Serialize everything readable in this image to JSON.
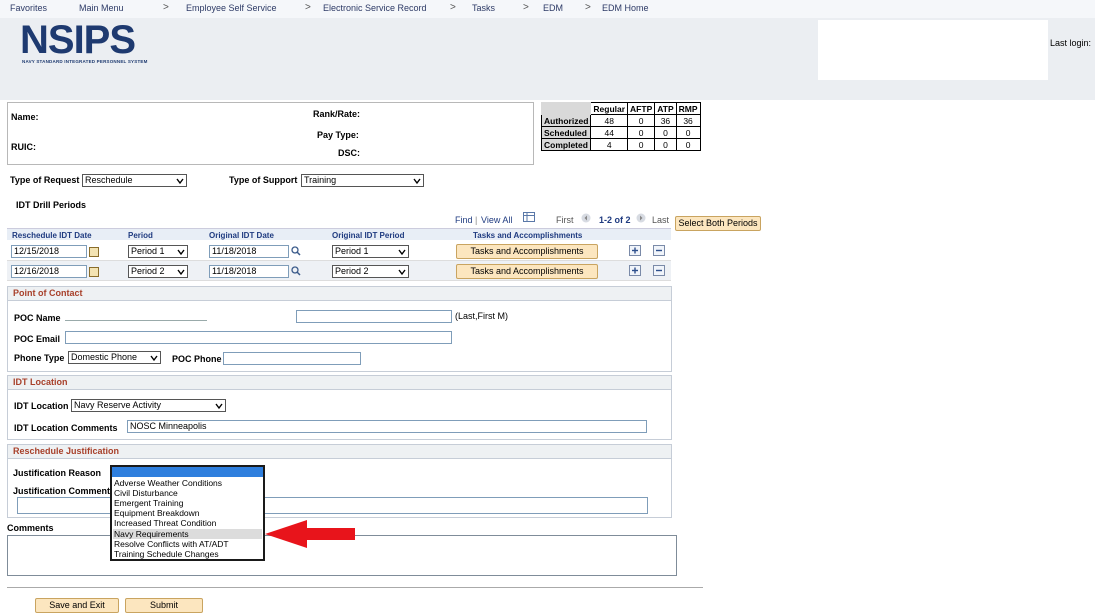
{
  "nav": {
    "favorites": "Favorites",
    "main_menu": "Main Menu",
    "crumbs": [
      "Employee Self Service",
      "Electronic Service Record",
      "Tasks",
      "EDM",
      "EDM Home"
    ],
    "sep": ">"
  },
  "header": {
    "logo_text": "NSIPS",
    "logo_subtitle": "NAVY STANDARD INTEGRATED PERSONNEL SYSTEM",
    "last_login_label": "Last login: "
  },
  "member": {
    "name_label": "Name:",
    "ruic_label": "RUIC:",
    "rank_label": "Rank/Rate:",
    "paytype_label": "Pay Type:",
    "dsc_label": "DSC:"
  },
  "stats": {
    "columns": [
      "Regular",
      "AFTP",
      "ATP",
      "RMP"
    ],
    "rows": [
      {
        "label": "Authorized",
        "values": [
          "48",
          "0",
          "36",
          "36"
        ]
      },
      {
        "label": "Scheduled",
        "values": [
          "44",
          "0",
          "0",
          "0"
        ]
      },
      {
        "label": "Completed",
        "values": [
          "4",
          "0",
          "0",
          "0"
        ]
      }
    ]
  },
  "request": {
    "type_label": "Type of Request",
    "type_value": "Reschedule",
    "support_label": "Type of Support",
    "support_value": "Training"
  },
  "drill": {
    "title": "IDT Drill Periods",
    "find": "Find",
    "view_all": "View All",
    "first": "First",
    "range": "1-2 of 2",
    "last": "Last",
    "select_both": "Select Both Periods",
    "col_reschedule": "Reschedule IDT Date",
    "col_period": "Period",
    "col_original_date": "Original IDT Date",
    "col_original_period": "Original IDT Period",
    "col_tasks": "Tasks and Accomplishments",
    "rows": [
      {
        "date": "12/15/2018",
        "period": "Period 1",
        "orig_date": "11/18/2018",
        "orig_period": "Period 1",
        "tasks_btn": "Tasks and Accomplishments"
      },
      {
        "date": "12/16/2018",
        "period": "Period 2",
        "orig_date": "11/18/2018",
        "orig_period": "Period 2",
        "tasks_btn": "Tasks and Accomplishments"
      }
    ]
  },
  "poc": {
    "title": "Point of Contact",
    "name_label": "POC Name",
    "name_hint": "(Last,First M)",
    "email_label": "POC Email",
    "phone_type_label": "Phone Type",
    "phone_type_value": "Domestic Phone",
    "phone_label": "POC Phone"
  },
  "location": {
    "title": "IDT Location",
    "location_label": "IDT Location",
    "location_value": "Navy Reserve Activity",
    "comments_label": "IDT Location Comments",
    "comments_value": "NOSC Minneapolis"
  },
  "justification": {
    "title": "Reschedule Justification",
    "reason_label": "Justification Reason",
    "comments_label": "Justification Comments",
    "options": [
      "Adverse Weather Conditions",
      "Civil Disturbance",
      "Emergent Training",
      "Equipment Breakdown",
      "Increased Threat Condition",
      "Navy Requirements",
      "Resolve Conflicts with AT/ADT",
      "Training Schedule Changes"
    ],
    "highlighted_option": "Navy Requirements"
  },
  "comments": {
    "label": "Comments"
  },
  "actions": {
    "save_exit": "Save and Exit",
    "submit": "Submit"
  },
  "colors": {
    "annotation_arrow": "#e8141b",
    "section_title": "#a8402a",
    "link": "#1f3b80"
  }
}
